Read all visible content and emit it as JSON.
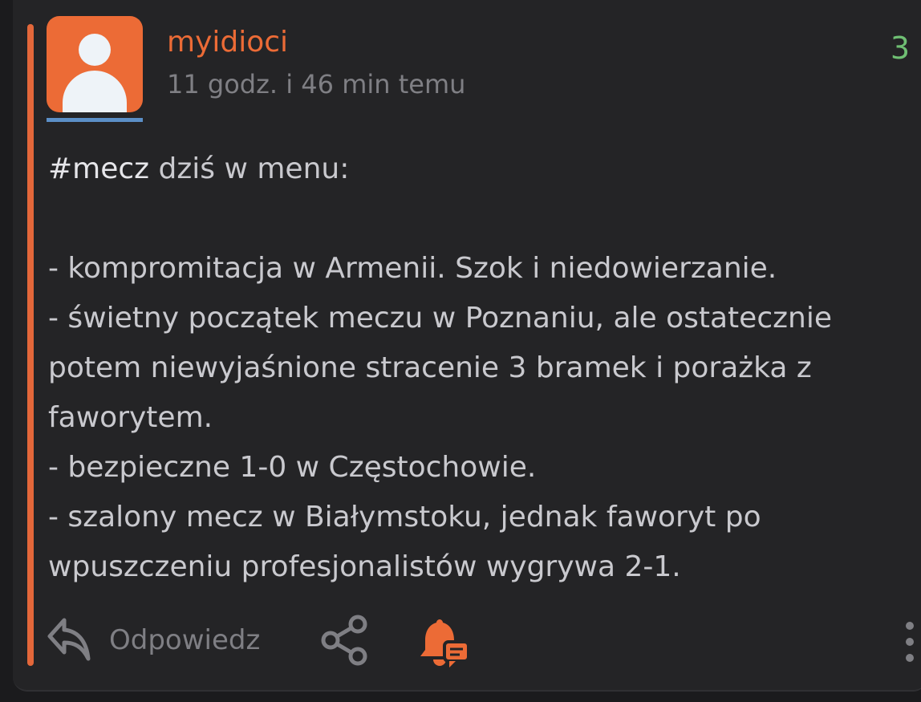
{
  "post": {
    "author": "myidioci",
    "time": "11 godz. i 46 min temu",
    "votes": "3",
    "hashtag": "#mecz",
    "lines": [
      " dziś w menu:",
      "",
      "- kompromitacja w Armenii. Szok i niedowierzanie.",
      "- świetny początek meczu w Poznaniu, ale ostatecznie",
      "potem niewyjaśnione stracenie 3 bramek i porażka z",
      "faworytem.",
      "- bezpieczne 1-0 w Częstochowie.",
      "- szalony mecz w Białymstoku, jednak faworyt po",
      "wpuszczeniu profesjonalistów wygrywa 2-1."
    ]
  },
  "actions": {
    "reply_label": "Odpowiedz",
    "icons": {
      "reply": "reply-icon",
      "share": "share-icon",
      "notify": "bell-comment-icon",
      "more": "more-vertical-icon"
    }
  },
  "colors": {
    "accent": "#e3673a",
    "author": "#ec6b36",
    "vote": "#6fbf73",
    "avatar_underline": "#5b8fc7",
    "background": "#242426"
  }
}
